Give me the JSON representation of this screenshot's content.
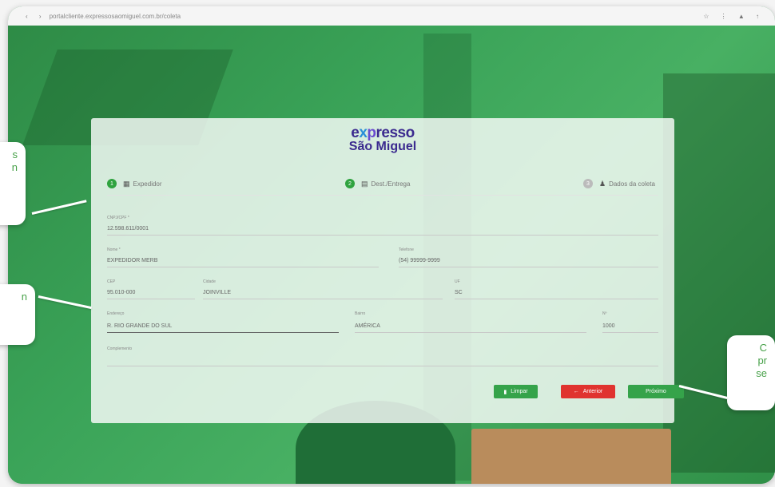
{
  "browser": {
    "nav": "‹ ›",
    "url": "portalcliente.expressosaomiguel.com.br/coleta",
    "right": "☆ ⋮ ▲ ↑"
  },
  "logo": {
    "line1_a": "e",
    "line1_x": "x",
    "line1_p": "p",
    "line1_rest": "resso",
    "line2": "São Miguel"
  },
  "steps": [
    {
      "num": "1",
      "label": "Expedidor"
    },
    {
      "num": "2",
      "label": "Dest./Entrega"
    },
    {
      "num": "3",
      "label": "Dados da coleta"
    }
  ],
  "form": {
    "cnpj": {
      "label": "CNPJ/CPF *",
      "value": "12.598.611/0001"
    },
    "razao": {
      "label": "Nome *",
      "value": "EXPEDIDOR MERB"
    },
    "telefone": {
      "label": "Telefone",
      "value": "(54) 99999-9999"
    },
    "cep": {
      "label": "CEP",
      "value": "95.010-000"
    },
    "cidade": {
      "label": "Cidade",
      "value": "JOINVILLE"
    },
    "uf": {
      "label": "UF",
      "value": "SC"
    },
    "endereco": {
      "label": "Endereço",
      "value": "R. RIO GRANDE DO SUL"
    },
    "bairro": {
      "label": "Bairro",
      "value": "AMÉRICA"
    },
    "numero": {
      "label": "Nº",
      "value": "1000"
    },
    "complemento": {
      "label": "Complemento",
      "value": ""
    }
  },
  "buttons": {
    "limpar": "Limpar",
    "anterior": "Anterior",
    "proximo": "Próximo"
  },
  "callouts": {
    "left_top": "s\nn",
    "left_mid": "n",
    "right": "C\npr\nse"
  },
  "colors": {
    "accent_green": "#35a34a",
    "danger_red": "#e0332f",
    "brand_purple": "#3b2a8f"
  }
}
